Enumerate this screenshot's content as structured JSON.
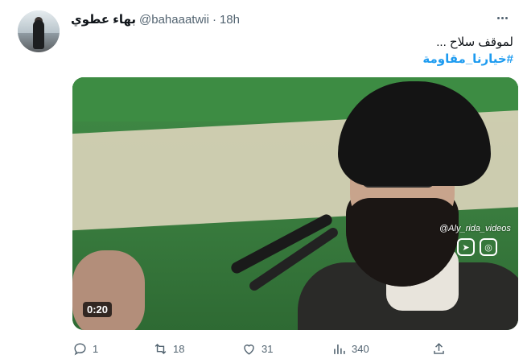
{
  "tweet": {
    "display_name": "بهاء عطوي",
    "handle": "@bahaaatwii",
    "separator": "·",
    "time": "18h",
    "text": "لموقف سلاح ...",
    "hashtag": "#خيارنا_مقاومة"
  },
  "media": {
    "duration": "0:20",
    "watermark": "@Aly_rida_videos",
    "icons": [
      "telegram-icon",
      "instagram-icon"
    ]
  },
  "actions": {
    "reply_count": "1",
    "retweet_count": "18",
    "like_count": "31",
    "views_count": "340"
  },
  "colors": {
    "accent": "#1d9bf0",
    "muted": "#536471",
    "text": "#0f1419"
  }
}
